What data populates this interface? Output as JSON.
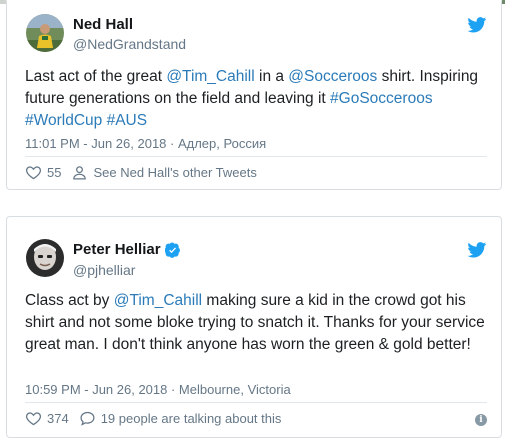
{
  "tweets": [
    {
      "author_name": "Ned Hall",
      "handle": "@NedGrandstand",
      "text_parts": {
        "p1": "Last act of the great ",
        "m1": "@Tim_Cahill",
        "p2": " in a ",
        "m2": "@Socceroos",
        "p3": " shirt. Inspiring future generations on the field and leaving it ",
        "h1": "#GoSocceroos",
        "h2": "#WorldCup",
        "h3": "#AUS"
      },
      "timestamp": "11:01 PM - Jun 26, 2018 · Адлер, Россия",
      "likes": "55",
      "secondary_action": "See Ned Hall's other Tweets",
      "avatar_icon": "avatar-photo-icon",
      "verified": false
    },
    {
      "author_name": "Peter Helliar",
      "handle": "@pjhelliar",
      "text_parts": {
        "p1": "Class act by ",
        "m1": "@Tim_Cahill",
        "p2": " making sure a kid in the crowd got his shirt and not some bloke trying to snatch it. Thanks for your service great man. I don't think anyone has worn the green & gold better!"
      },
      "timestamp": "10:59 PM - Jun 26, 2018 · Melbourne, Victoria",
      "likes": "374",
      "secondary_action": "19 people are talking about this",
      "avatar_icon": "avatar-photo-icon",
      "verified": true
    }
  ],
  "colors": {
    "link": "#2b7bb9",
    "twitter_blue": "#1da1f2",
    "meta_gray": "#657786",
    "border": "#d8dde2"
  },
  "icons": {
    "brand": "twitter-bird-icon",
    "like": "heart-icon",
    "profile": "person-icon",
    "reply": "speech-bubble-icon",
    "info": "info-icon",
    "verified": "verified-badge-icon"
  }
}
